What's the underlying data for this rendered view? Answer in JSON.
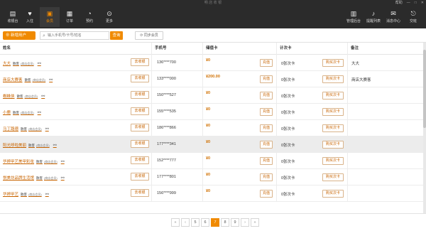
{
  "window": {
    "title": "畅 店 收 银",
    "help": "帮助",
    "controls": [
      "—",
      "□",
      "✕"
    ]
  },
  "nav_left": [
    {
      "label": "收银台",
      "icon": "▤"
    },
    {
      "label": "入住",
      "icon": "♥"
    },
    {
      "label": "会员",
      "icon": "▣",
      "active": true
    },
    {
      "label": "订单",
      "icon": "▦"
    },
    {
      "label": "预约",
      "icon": "◔"
    },
    {
      "label": "更多",
      "icon": "⊙"
    }
  ],
  "nav_right": [
    {
      "label": "管理后台",
      "icon": "▥"
    },
    {
      "label": "提醒列表",
      "icon": "♪"
    },
    {
      "label": "消息中心",
      "icon": "✉"
    },
    {
      "label": "交班",
      "icon": "⎋"
    }
  ],
  "toolbar": {
    "add_label": "新增用户",
    "search_placeholder": "输入手机号/卡号/姓名",
    "query_label": "查询",
    "sync_label": "同步会员"
  },
  "table": {
    "headers": {
      "name": "姓名",
      "phone": "手机号",
      "store": "储值卡",
      "count": "计次卡",
      "note": "备注"
    },
    "rows": [
      {
        "name": "大大",
        "tag": "散客",
        "tag2": "(商店会员)",
        "phone": "136****700",
        "store": "¥0",
        "count": "0张次卡",
        "note": "大大"
      },
      {
        "name": "商店大赛客",
        "tag": "散客",
        "tag2": "(商店会员)",
        "phone": "133****000",
        "store": "¥200.00",
        "count": "0张次卡",
        "note": "商店大赛客"
      },
      {
        "name": "蜘蛛侠",
        "tag": "散客",
        "tag2": "(商店会员)",
        "phone": "150****527",
        "store": "¥0",
        "count": "0张次卡",
        "note": ""
      },
      {
        "name": "小鹿",
        "tag": "散客",
        "tag2": "(商店会员)",
        "phone": "155****535",
        "store": "¥0",
        "count": "0张次卡",
        "note": ""
      },
      {
        "name": "马丁路德",
        "tag": "散客",
        "tag2": "(商店会员)",
        "phone": "186****866",
        "store": "¥0",
        "count": "0张次卡",
        "note": ""
      },
      {
        "name": "阳光哆啦美丽",
        "tag": "散客",
        "tag2": "(商店会员)",
        "phone": "177****341",
        "store": "¥0",
        "count": "0张次卡",
        "note": "",
        "selected": true
      },
      {
        "name": "华婷甲艺美甲彩妆",
        "tag": "散客",
        "tag2": "(商店会员)",
        "phone": "152****777",
        "store": "¥0",
        "count": "0张次卡",
        "note": ""
      },
      {
        "name": "悦美坊品牌生活馆",
        "tag": "散客",
        "tag2": "(商店会员)",
        "phone": "177****801",
        "store": "¥0",
        "count": "0张次卡",
        "note": ""
      },
      {
        "name": "华婷甲艺",
        "tag": "散客",
        "tag2": "(商店会员)",
        "phone": "156****999",
        "store": "¥0",
        "count": "0张次卡",
        "note": ""
      }
    ],
    "recharge_count_label": "去收银",
    "recharge_label": "充值",
    "buy_label": "购买次卡",
    "link_icon": "⚯"
  },
  "pager": {
    "first": "«",
    "prev": "‹",
    "pages": [
      "5",
      "6",
      "7",
      "8",
      "9"
    ],
    "current": "7",
    "next": "›",
    "last": "»"
  }
}
